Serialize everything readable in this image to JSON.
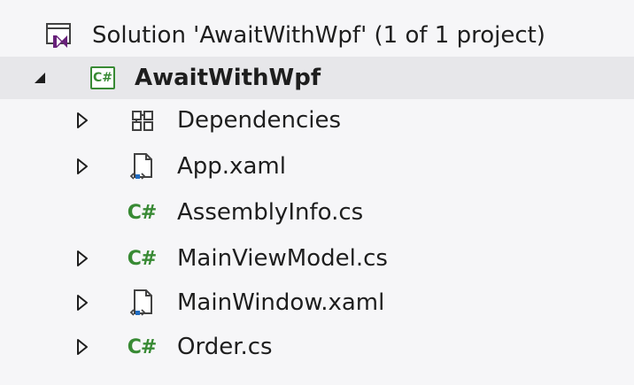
{
  "tree": {
    "solution_label": "Solution 'AwaitWithWpf' (1 of 1 project)",
    "project_label": "AwaitWithWpf",
    "project_icon_text": "C#",
    "cs_icon_text": "C#",
    "items": [
      {
        "label": "Dependencies",
        "icon": "dependencies-icon",
        "expandable": true
      },
      {
        "label": "App.xaml",
        "icon": "xaml-file-icon",
        "expandable": true
      },
      {
        "label": "AssemblyInfo.cs",
        "icon": "csharp-file-icon",
        "expandable": false
      },
      {
        "label": "MainViewModel.cs",
        "icon": "csharp-file-icon",
        "expandable": true
      },
      {
        "label": "MainWindow.xaml",
        "icon": "xaml-file-icon",
        "expandable": true
      },
      {
        "label": "Order.cs",
        "icon": "csharp-file-icon",
        "expandable": true
      }
    ]
  },
  "colors": {
    "background": "#f6f6f8",
    "selection": "#e7e7ea",
    "csharp_green": "#388a34",
    "vs_purple": "#68217a",
    "xaml_blue": "#1f6bc1",
    "text": "#1e1e1e"
  }
}
